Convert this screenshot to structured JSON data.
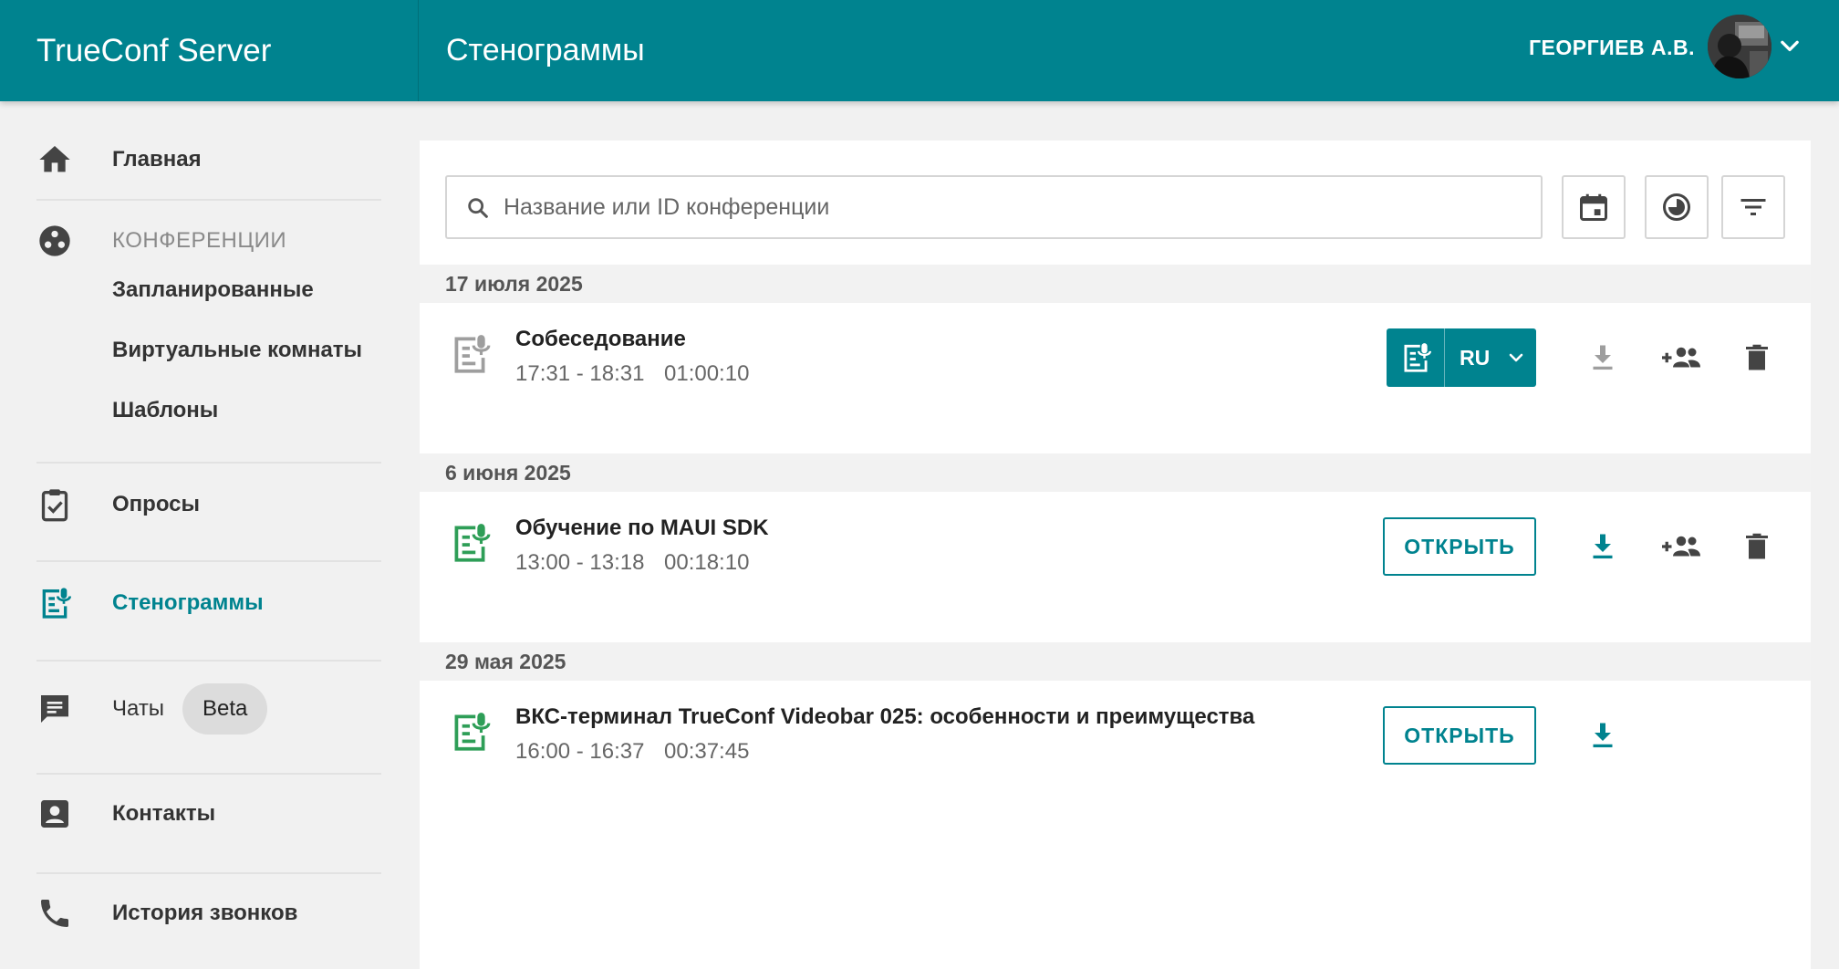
{
  "app": {
    "brand": "TrueConf Server",
    "page_title": "Стенограммы"
  },
  "user": {
    "name": "ГЕОРГИЕВ А.В."
  },
  "sidebar": {
    "home": "Главная",
    "conferences_section": "КОНФЕРЕНЦИИ",
    "conf_sub": [
      "Запланированные",
      "Виртуальные комнаты",
      "Шаблоны"
    ],
    "polls": "Опросы",
    "transcripts": "Стенограммы",
    "chats": "Чаты",
    "chats_badge": "Beta",
    "contacts": "Контакты",
    "call_history": "История звонков"
  },
  "search": {
    "placeholder": "Название или ID конференции",
    "value": ""
  },
  "groups": [
    {
      "date": "17 июля 2025",
      "items": [
        {
          "title": "Собеседование",
          "time": "17:31 - 18:31",
          "duration": "01:00:10",
          "language": "RU"
        }
      ]
    },
    {
      "date": "6 июня 2025",
      "items": [
        {
          "title": "Обучение по MAUI SDK",
          "time": "13:00 - 13:18",
          "duration": "00:18:10",
          "open_label": "ОТКРЫТЬ"
        }
      ]
    },
    {
      "date": "29 мая 2025",
      "items": [
        {
          "title": "ВКС-терминал TrueConf Videobar 025: особенности и преимущества",
          "time": "16:00 - 16:37",
          "duration": "00:37:45",
          "open_label": "ОТКРЫТЬ"
        }
      ]
    }
  ],
  "colors": {
    "primary": "#00838f",
    "transcript_ready": "#2e9e57",
    "transcript_pending": "#9e9e9e",
    "icon_gray": "#555555"
  }
}
